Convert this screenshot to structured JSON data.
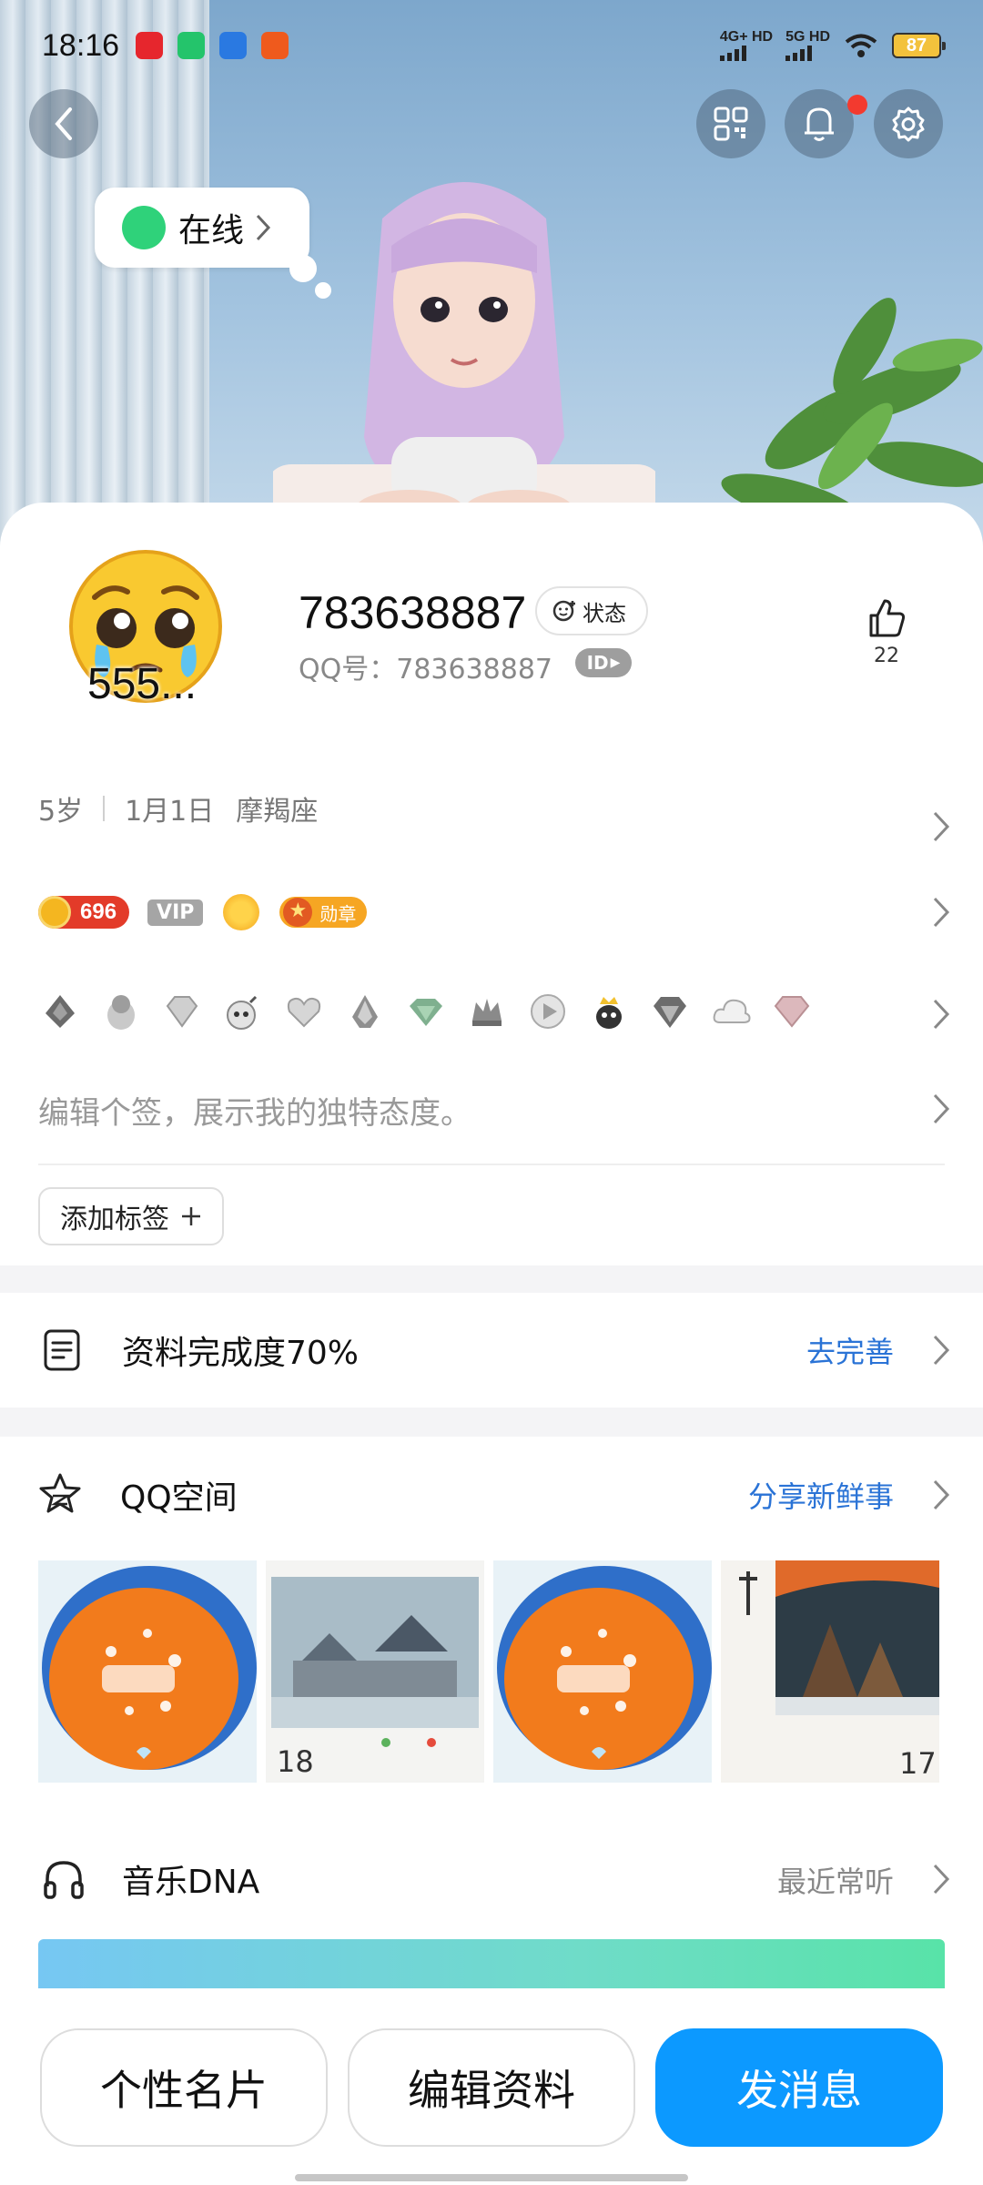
{
  "status_bar": {
    "time": "18:16",
    "sim1_label": "4G+ HD",
    "sim2_label": "5G HD",
    "battery": "87"
  },
  "hero": {
    "online_status": "在线"
  },
  "profile": {
    "avatar_caption": "555...",
    "nickname": "783638887",
    "status_button": "状态",
    "qq_number_label": "QQ号：783638887",
    "id_badge": "ID",
    "like_count": "22"
  },
  "info": {
    "age": "5岁",
    "birthday": "1月1日",
    "zodiac": "摩羯座"
  },
  "badges": {
    "coin_value": "696",
    "vip": "VIP",
    "medal": "勋章"
  },
  "signature_placeholder": "编辑个签，展示我的独特态度。",
  "add_tag_button": "添加标签",
  "completion": {
    "title": "资料完成度70%",
    "action": "去完善"
  },
  "qzone": {
    "title": "QQ空间",
    "action": "分享新鲜事",
    "thumb2_date": "18",
    "thumb4_date": "17"
  },
  "music": {
    "title": "音乐DNA",
    "action": "最近常听"
  },
  "actions": {
    "card": "个性名片",
    "edit": "编辑资料",
    "message": "发消息"
  },
  "colors": {
    "accent_blue": "#0c99ff",
    "link_blue": "#2a73d6",
    "online_green": "#2fd27a"
  }
}
